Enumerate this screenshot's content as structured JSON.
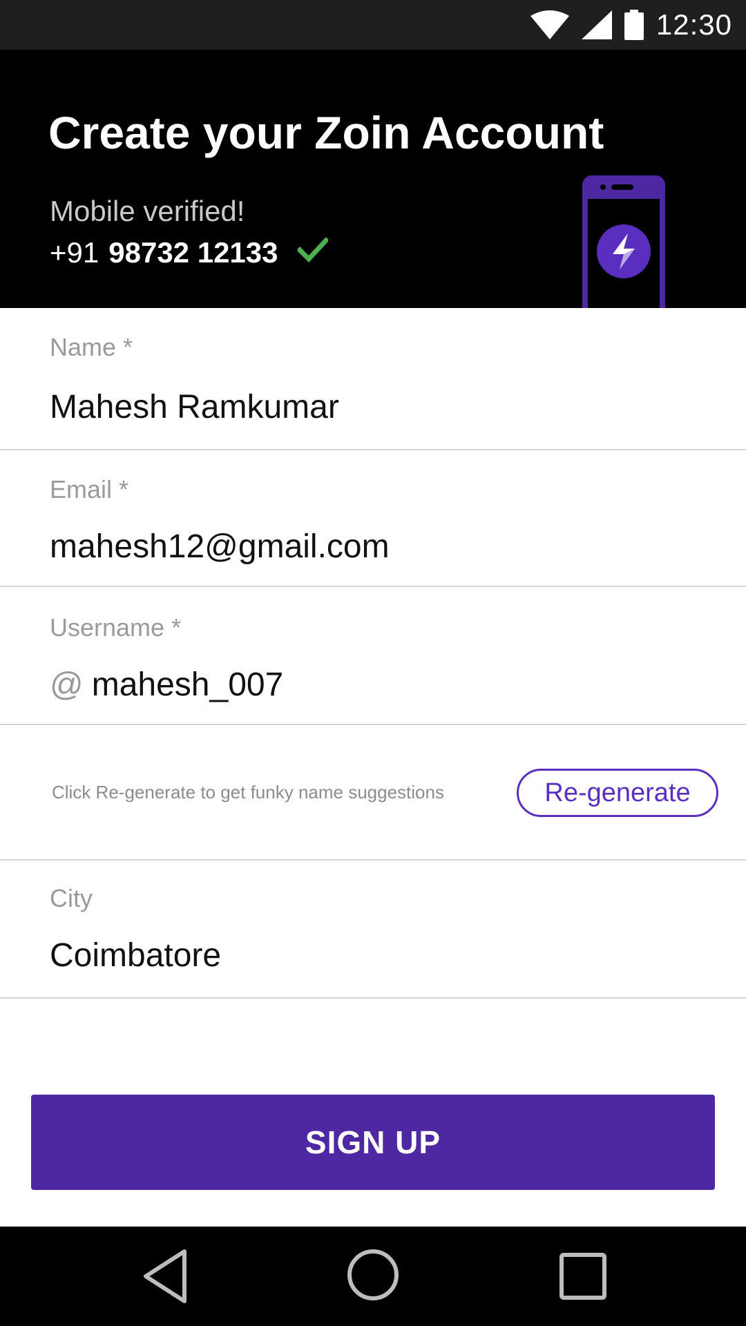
{
  "status_bar": {
    "time": "12:30",
    "icons": [
      "wifi-icon",
      "signal-icon",
      "battery-icon"
    ]
  },
  "header": {
    "title": "Create your Zoin Account",
    "verified_label": "Mobile verified!",
    "phone_prefix": "+91",
    "phone_number": "98732 12133",
    "check_icon": "check-icon",
    "illustration_icon": "phone-bolt-icon"
  },
  "form": {
    "name": {
      "label": "Name *",
      "value": "Mahesh Ramkumar"
    },
    "email": {
      "label": "Email *",
      "value": "mahesh12@gmail.com"
    },
    "username": {
      "label": "Username *",
      "prefix": "@",
      "value": "mahesh_007"
    },
    "hint": "Click Re-generate to get funky name suggestions",
    "regenerate_label": "Re-generate",
    "city": {
      "label": "City",
      "value": "Coimbatore"
    }
  },
  "signup_label": "SIGN UP",
  "nav": {
    "icons": [
      "back-icon",
      "home-icon",
      "recents-icon"
    ]
  },
  "colors": {
    "accent": "#4e27a3",
    "outline": "#5a2fbf",
    "check": "#4caf50",
    "header_bg": "#000000",
    "status_bg": "#1f1f1f"
  }
}
